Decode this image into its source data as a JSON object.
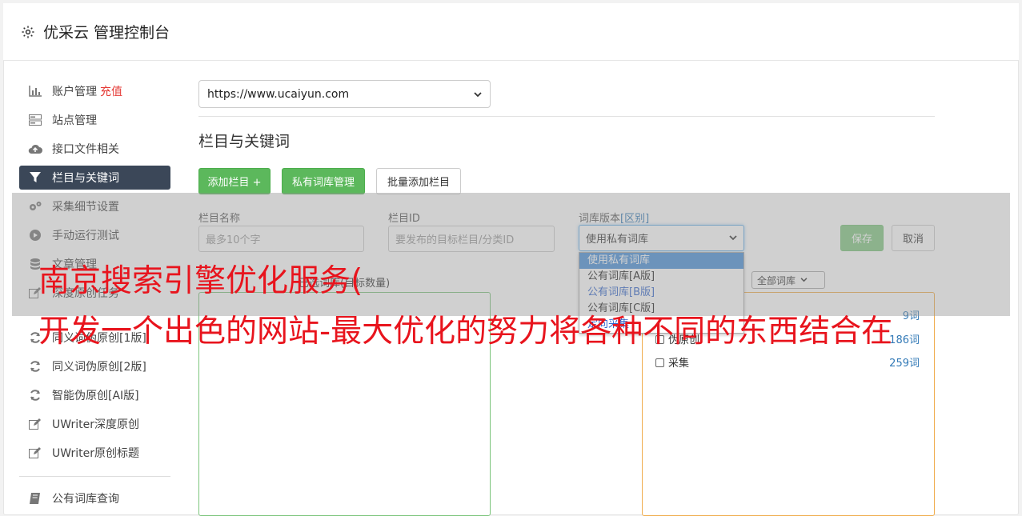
{
  "header": {
    "title": "优采云 管理控制台"
  },
  "sidebar": {
    "items": [
      {
        "label": "账户管理",
        "badge": "充值",
        "icon": "bar-chart-icon"
      },
      {
        "label": "站点管理",
        "icon": "server-icon"
      },
      {
        "label": "接口文件相关",
        "icon": "cloud-upload-icon"
      },
      {
        "label": "栏目与关键词",
        "icon": "filter-icon",
        "active": true
      },
      {
        "label": "采集细节设置",
        "icon": "gears-icon"
      },
      {
        "label": "手动运行测试",
        "icon": "play-circle-icon"
      },
      {
        "label": "文章管理",
        "icon": "database-icon"
      },
      {
        "label": "深度原创任务",
        "icon": "edit-icon"
      },
      {
        "label": "同义词伪原创[1版]",
        "icon": "refresh-icon"
      },
      {
        "label": "同义词伪原创[2版]",
        "icon": "refresh-icon"
      },
      {
        "label": "智能伪原创[AI版]",
        "icon": "refresh-icon"
      },
      {
        "label": "UWriter深度原创",
        "icon": "edit-icon"
      },
      {
        "label": "UWriter原创标题",
        "icon": "edit-icon"
      },
      {
        "label": "公有词库查询",
        "icon": "book-icon"
      }
    ]
  },
  "main": {
    "site_select": "https://www.ucaiyun.com",
    "section_title": "栏目与关键词",
    "buttons": {
      "add_column": "添加栏目 +",
      "private_lib": "私有词库管理",
      "batch_add": "批量添加栏目"
    },
    "form": {
      "name_label": "栏目名称",
      "name_placeholder": "最多10个字",
      "id_label": "栏目ID",
      "id_placeholder": "要发布的目标栏目/分类ID",
      "lib_label": "词库版本",
      "lib_label_link": "[区别]",
      "lib_value": "使用私有词库",
      "lib_options": [
        "使用私有词库",
        "公有词库[A版]",
        "公有词库[B版]",
        "公有词库[C版]",
        "定向采集"
      ],
      "save": "保存",
      "cancel": "取消"
    },
    "selected_hint": "已选词库(目标数量)",
    "filter_select": "全部词库",
    "library_rows": [
      {
        "name": "",
        "count": "9词"
      },
      {
        "name": "伪原创",
        "count": "186词"
      },
      {
        "name": "采集",
        "count": "259词"
      }
    ]
  },
  "overlay": {
    "line1": "南京搜索引擎优化服务(",
    "line2": "开发一个出色的网站-最大优化的努力将各种不同的东西结合在"
  }
}
